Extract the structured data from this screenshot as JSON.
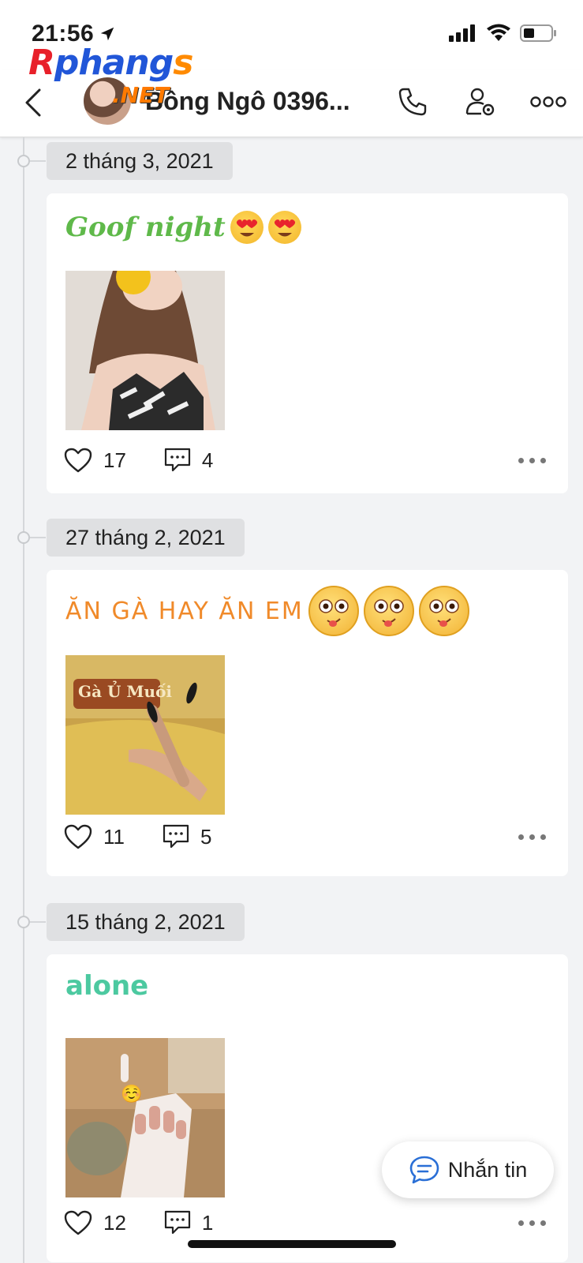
{
  "status_bar": {
    "time": "21:56",
    "location_icon": "location-arrow-icon",
    "signal_icon": "cellular-signal-icon",
    "wifi_icon": "wifi-icon",
    "battery_icon": "battery-icon"
  },
  "watermark": {
    "logo_r": "R",
    "logo_phang": "phang",
    "logo_s": "s",
    "logo_net": ".NET"
  },
  "header": {
    "contact_name": "Bông Ngô 0396...",
    "back_icon": "chevron-left-icon",
    "call_icon": "phone-icon",
    "settings_icon": "user-settings-icon",
    "more_icon": "more-horizontal-icon"
  },
  "posts": [
    {
      "date": "2 tháng 3, 2021",
      "text": "Goof night",
      "emojis": "😍😍",
      "likes": "17",
      "comments": "4",
      "text_color": "#5fb94a"
    },
    {
      "date": "27 tháng 2, 2021",
      "text": "ĂN GÀ HAY ĂN EM",
      "emojis": "😳😳😳",
      "likes": "11",
      "comments": "5",
      "photo_label": "Gà Ủ Muối",
      "text_color": "#f08a2a"
    },
    {
      "date": "15 tháng 2, 2021",
      "text": "alone",
      "likes": "12",
      "comments": "1",
      "photo_emoji": "☺️",
      "text_color": "#4cc9a0"
    }
  ],
  "message_button": {
    "label": "Nhắn tin",
    "icon": "chat-bubble-icon"
  }
}
